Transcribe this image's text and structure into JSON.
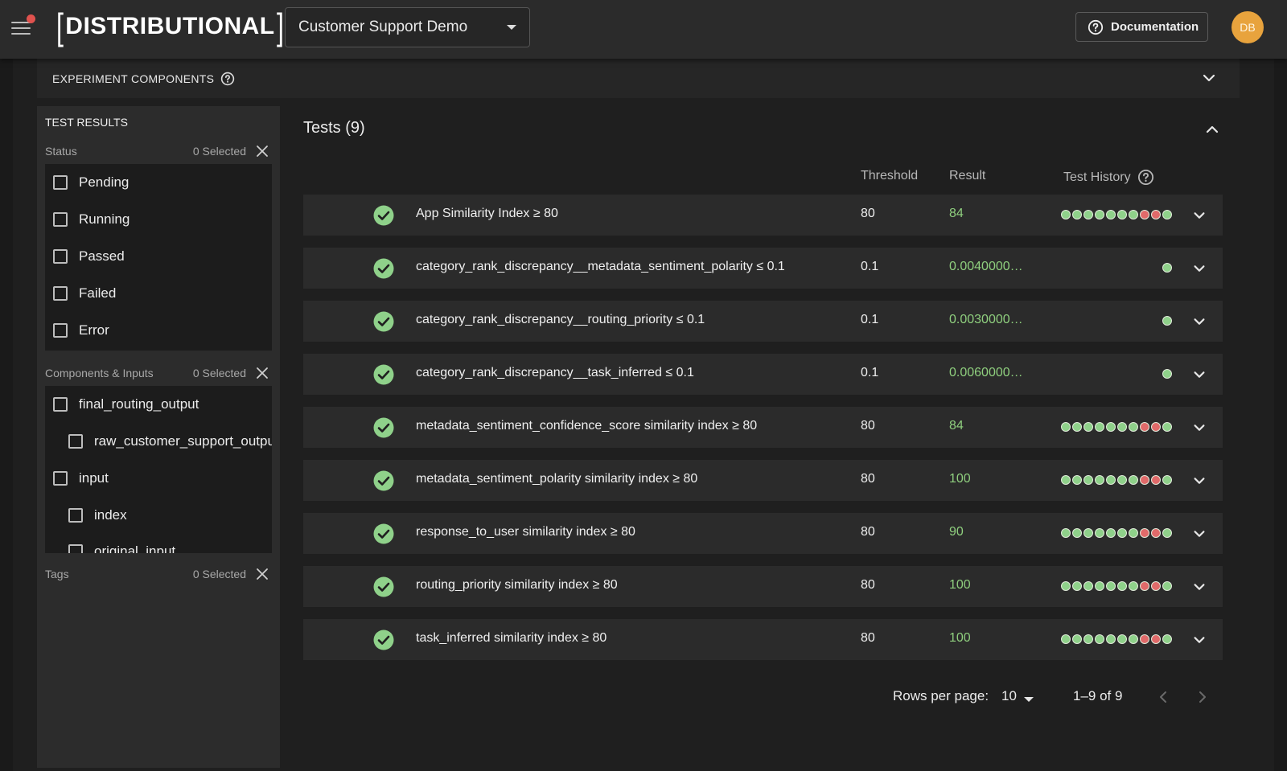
{
  "header": {
    "logo_text": "DISTRIBUTIONAL",
    "project": "Customer Support Demo",
    "docs_label": "Documentation",
    "avatar_initials": "DB",
    "notification_color": "#e0524e",
    "avatar_color": "#e8a33d"
  },
  "experiment": {
    "label": "EXPERIMENT COMPONENTS"
  },
  "sidebar": {
    "title": "TEST RESULTS",
    "status": {
      "label": "Status",
      "selected": "0 Selected",
      "options": [
        "Pending",
        "Running",
        "Passed",
        "Failed",
        "Error"
      ]
    },
    "components": {
      "label": "Components & Inputs",
      "selected": "0 Selected",
      "options": [
        "final_routing_output",
        "raw_customer_support_output",
        "input",
        "index",
        "original_input"
      ]
    },
    "tags": {
      "label": "Tags",
      "selected": "0 Selected"
    }
  },
  "tests": {
    "title": "Tests (9)",
    "columns": {
      "threshold": "Threshold",
      "result": "Result",
      "history": "Test History"
    },
    "rows": [
      {
        "name": "App Similarity Index ≥ 80",
        "threshold": "80",
        "result": "84",
        "history": [
          "pass",
          "pass",
          "pass",
          "pass",
          "pass",
          "pass",
          "pass",
          "fail",
          "fail",
          "pass"
        ]
      },
      {
        "name": "category_rank_discrepancy__metadata_sentiment_polarity ≤ 0.1",
        "threshold": "0.1",
        "result": "0.0040000…",
        "history": [
          "pass"
        ]
      },
      {
        "name": "category_rank_discrepancy__routing_priority ≤ 0.1",
        "threshold": "0.1",
        "result": "0.0030000…",
        "history": [
          "pass"
        ]
      },
      {
        "name": "category_rank_discrepancy__task_inferred ≤ 0.1",
        "threshold": "0.1",
        "result": "0.0060000…",
        "history": [
          "pass"
        ]
      },
      {
        "name": "metadata_sentiment_confidence_score similarity index ≥ 80",
        "threshold": "80",
        "result": "84",
        "history": [
          "pass",
          "pass",
          "pass",
          "pass",
          "pass",
          "pass",
          "pass",
          "fail",
          "fail",
          "pass"
        ]
      },
      {
        "name": "metadata_sentiment_polarity similarity index ≥ 80",
        "threshold": "80",
        "result": "100",
        "history": [
          "pass",
          "pass",
          "pass",
          "pass",
          "pass",
          "pass",
          "pass",
          "fail",
          "fail",
          "pass"
        ]
      },
      {
        "name": "response_to_user similarity index ≥ 80",
        "threshold": "80",
        "result": "90",
        "history": [
          "pass",
          "pass",
          "pass",
          "pass",
          "pass",
          "pass",
          "pass",
          "fail",
          "fail",
          "pass"
        ]
      },
      {
        "name": "routing_priority similarity index ≥ 80",
        "threshold": "80",
        "result": "100",
        "history": [
          "pass",
          "pass",
          "pass",
          "pass",
          "pass",
          "pass",
          "pass",
          "fail",
          "fail",
          "pass"
        ]
      },
      {
        "name": "task_inferred similarity index ≥ 80",
        "threshold": "80",
        "result": "100",
        "history": [
          "pass",
          "pass",
          "pass",
          "pass",
          "pass",
          "pass",
          "pass",
          "fail",
          "fail",
          "pass"
        ]
      }
    ],
    "colors": {
      "pass": "#8fd18a",
      "fail": "#e06a6a",
      "result_text": "#8fcf7e",
      "check": "#8fd18a"
    }
  },
  "pagination": {
    "rows_per_page_label": "Rows per page:",
    "rows_per_page": "10",
    "range": "1–9 of 9"
  }
}
